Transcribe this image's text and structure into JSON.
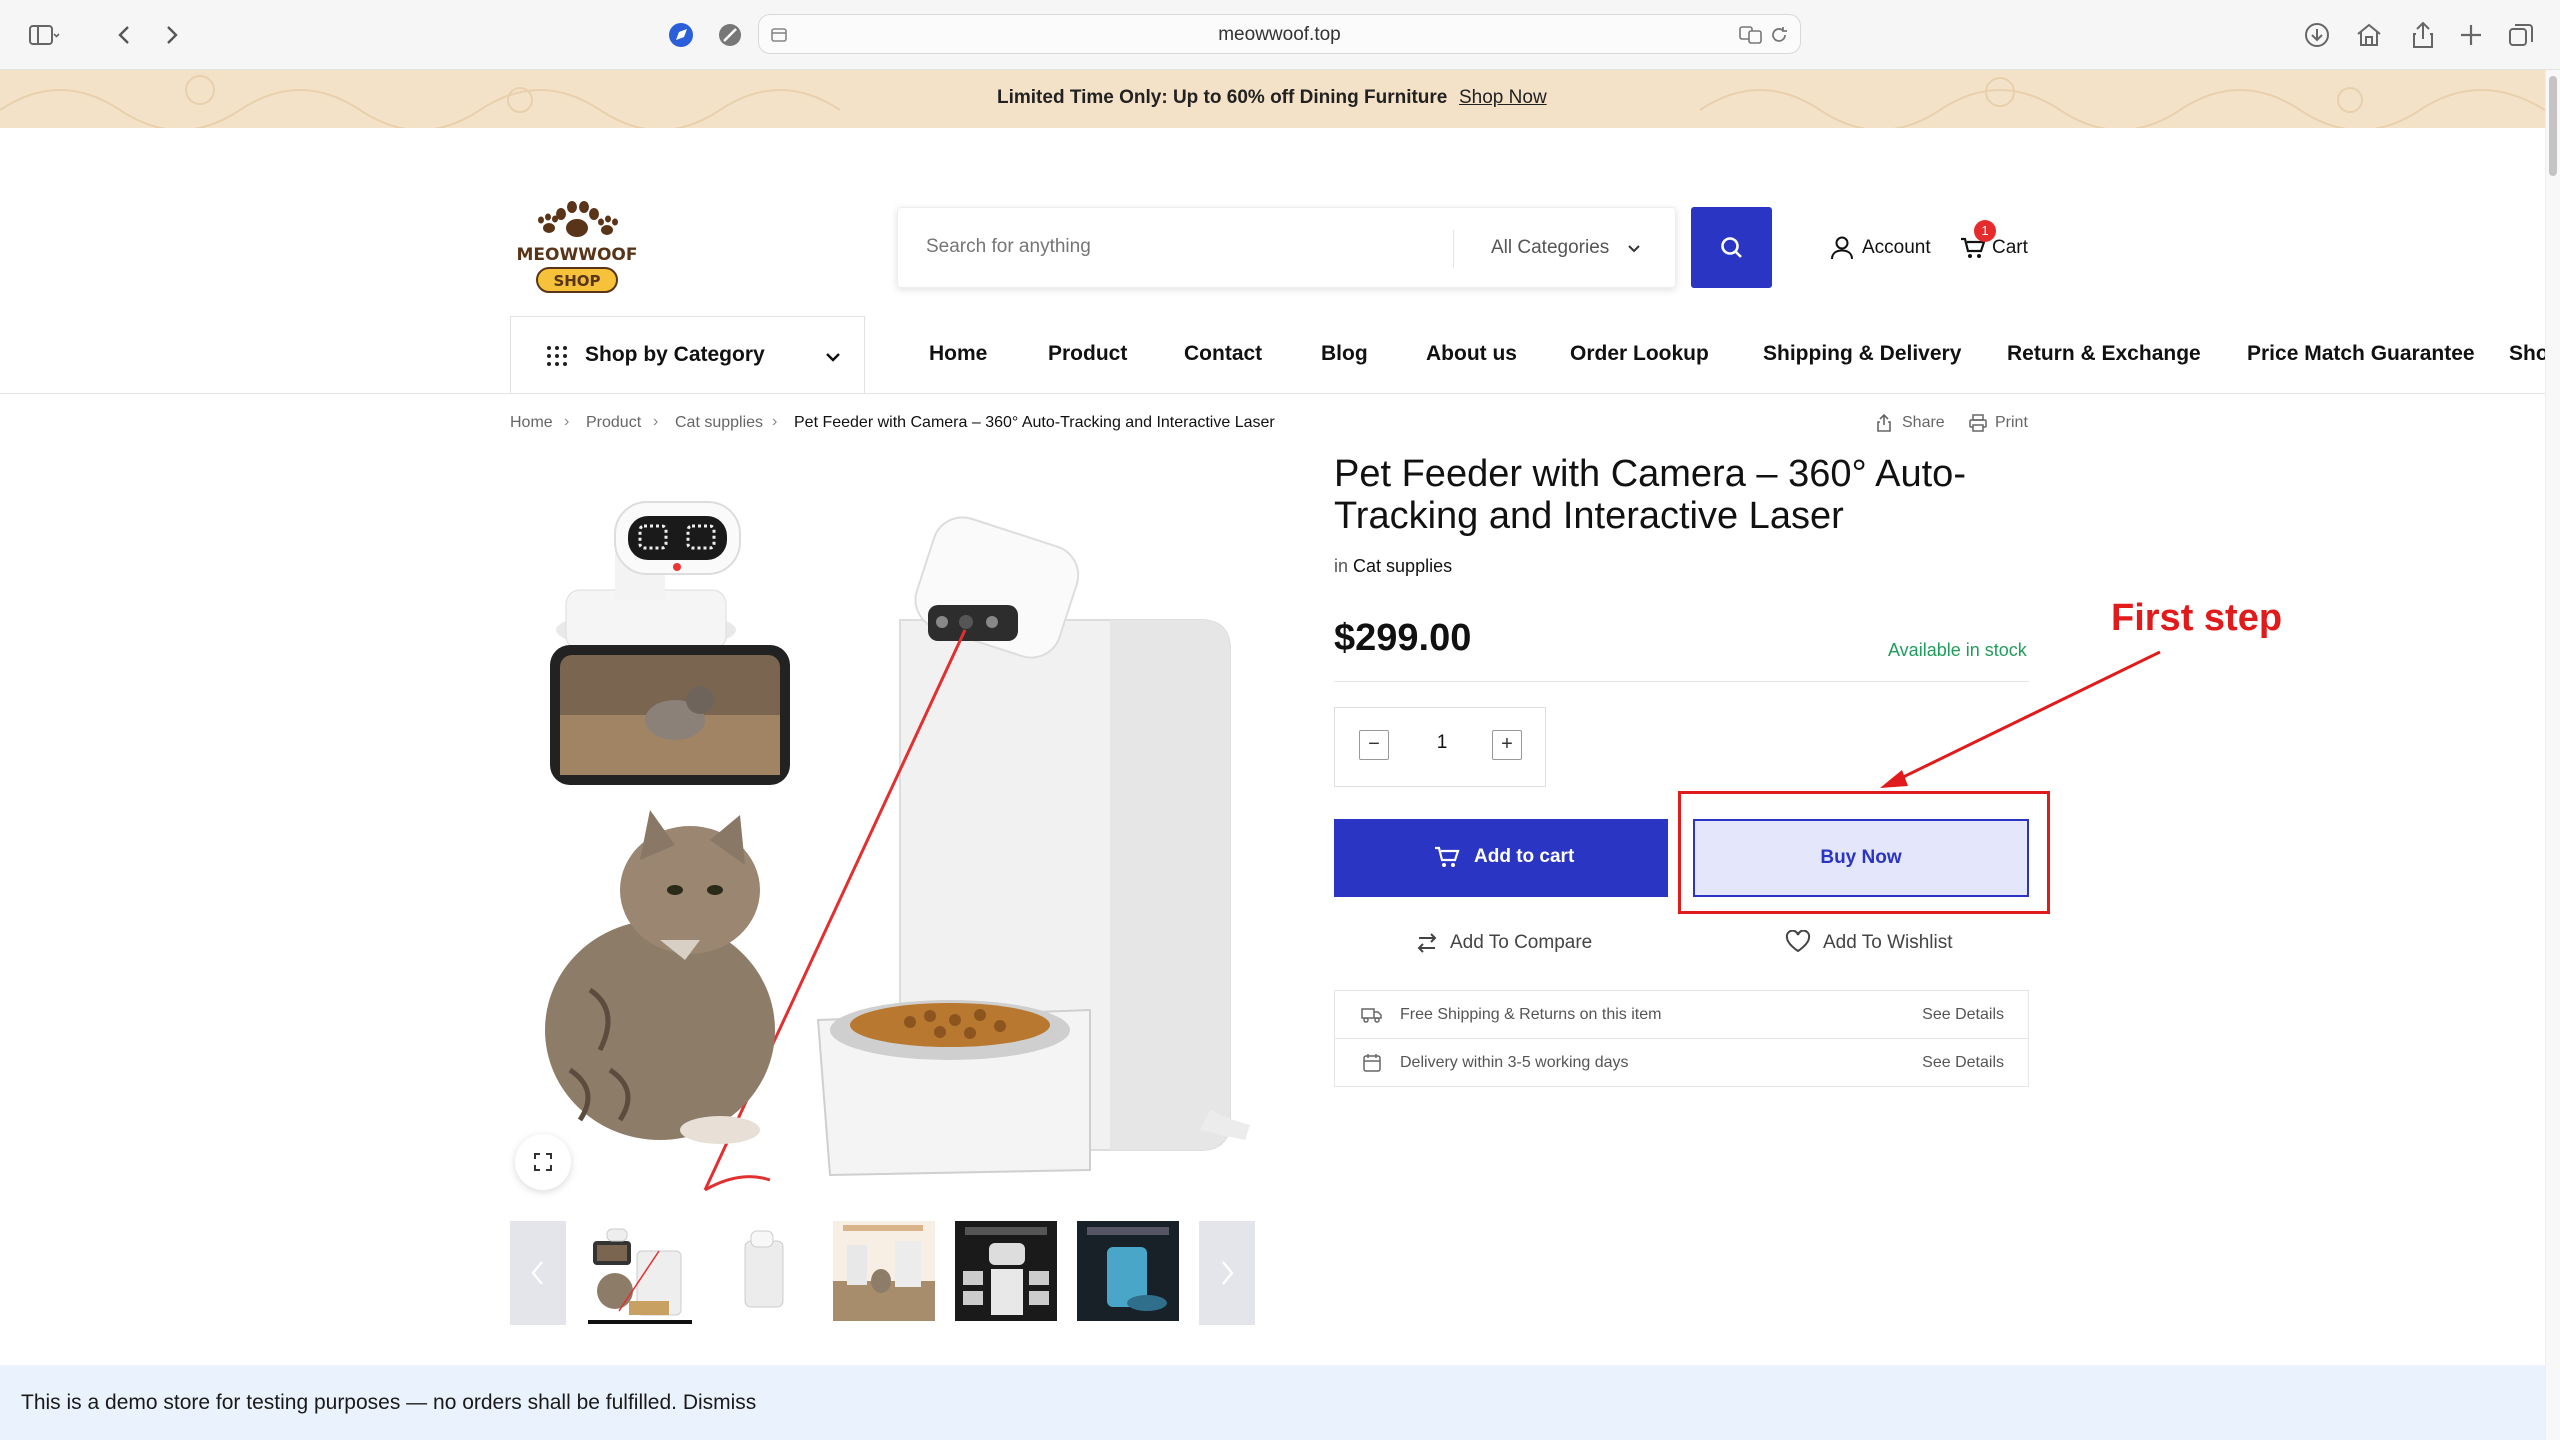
{
  "browser": {
    "url": "meowwoof.top"
  },
  "promo": {
    "text": "Limited Time Only: Up to 60% off Dining Furniture",
    "link": "Shop Now"
  },
  "header": {
    "logo_text": "MEOWWOOF SHOP",
    "search_placeholder": "Search for anything",
    "category_select": "All Categories",
    "account": "Account",
    "cart": "Cart",
    "cart_count": "1"
  },
  "nav": {
    "shop_by_category": "Shop by Category",
    "items": [
      "Home",
      "Product",
      "Contact",
      "Blog",
      "About us",
      "Order Lookup",
      "Shipping & Delivery",
      "Return & Exchange",
      "Price Match Guarantee",
      "Sho"
    ]
  },
  "breadcrumb": [
    "Home",
    "Product",
    "Cat supplies",
    "Pet Feeder with Camera – 360° Auto-Tracking and Interactive Laser"
  ],
  "tools": {
    "share": "Share",
    "print": "Print"
  },
  "product": {
    "title": "Pet Feeder with Camera – 360° Auto-Tracking and Interactive Laser",
    "in_label": "in",
    "category": "Cat supplies",
    "price": "$299.00",
    "stock": "Available in stock",
    "quantity": "1",
    "add_to_cart": "Add to cart",
    "buy_now": "Buy Now",
    "add_to_compare": "Add To Compare",
    "add_to_wishlist": "Add To Wishlist",
    "info": [
      {
        "text": "Free Shipping & Returns on this item",
        "link": "See Details"
      },
      {
        "text": "Delivery within 3-5 working days",
        "link": "See Details"
      }
    ]
  },
  "annotation": {
    "label": "First step"
  },
  "notice": {
    "text": "This is a demo store for testing purposes — no orders shall be fulfilled. Dismiss"
  },
  "colors": {
    "primary": "#2a35c4",
    "promo_bg": "#f4e2c8",
    "stock_green": "#1f9d5a",
    "annotation_red": "#e11b1b",
    "notice_bg": "#eaf3fd"
  }
}
